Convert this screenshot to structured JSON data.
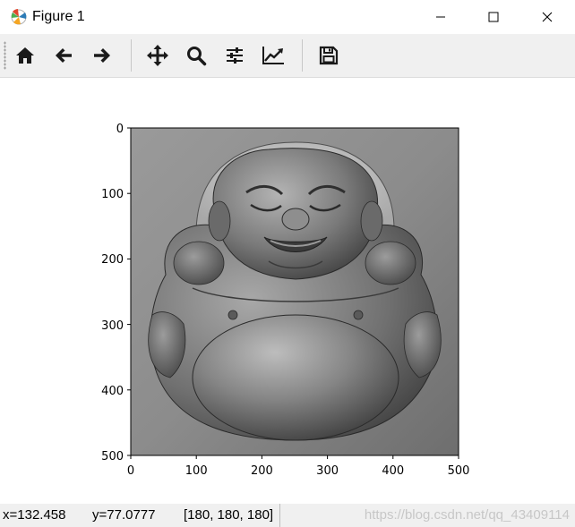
{
  "window": {
    "title": "Figure 1",
    "controls": [
      "minimize-icon",
      "maximize-icon",
      "close-icon"
    ]
  },
  "toolbar": {
    "tools": [
      {
        "name": "home",
        "icon": "home-icon"
      },
      {
        "name": "back",
        "icon": "arrow-left-icon"
      },
      {
        "name": "forward",
        "icon": "arrow-right-icon"
      },
      {
        "name": "pan",
        "icon": "move-icon"
      },
      {
        "name": "zoom",
        "icon": "magnifier-icon"
      },
      {
        "name": "configure-subplots",
        "icon": "sliders-icon"
      },
      {
        "name": "edit-axes",
        "icon": "line-chart-icon"
      },
      {
        "name": "save",
        "icon": "floppy-disk-icon"
      }
    ]
  },
  "plot": {
    "x_ticks": [
      "0",
      "100",
      "200",
      "300",
      "400",
      "500"
    ],
    "y_ticks": [
      "0",
      "100",
      "200",
      "300",
      "400",
      "500"
    ],
    "image_content": "grayscale relief image of laughing buddha"
  },
  "status": {
    "x": "x=132.458",
    "y": "y=77.0777",
    "pixel": "[180, 180, 180]",
    "watermark": "https://blog.csdn.net/qq_43409114"
  },
  "colors": {
    "toolbar_bg": "#f0f0f0",
    "icon": "#1a1a1a"
  }
}
